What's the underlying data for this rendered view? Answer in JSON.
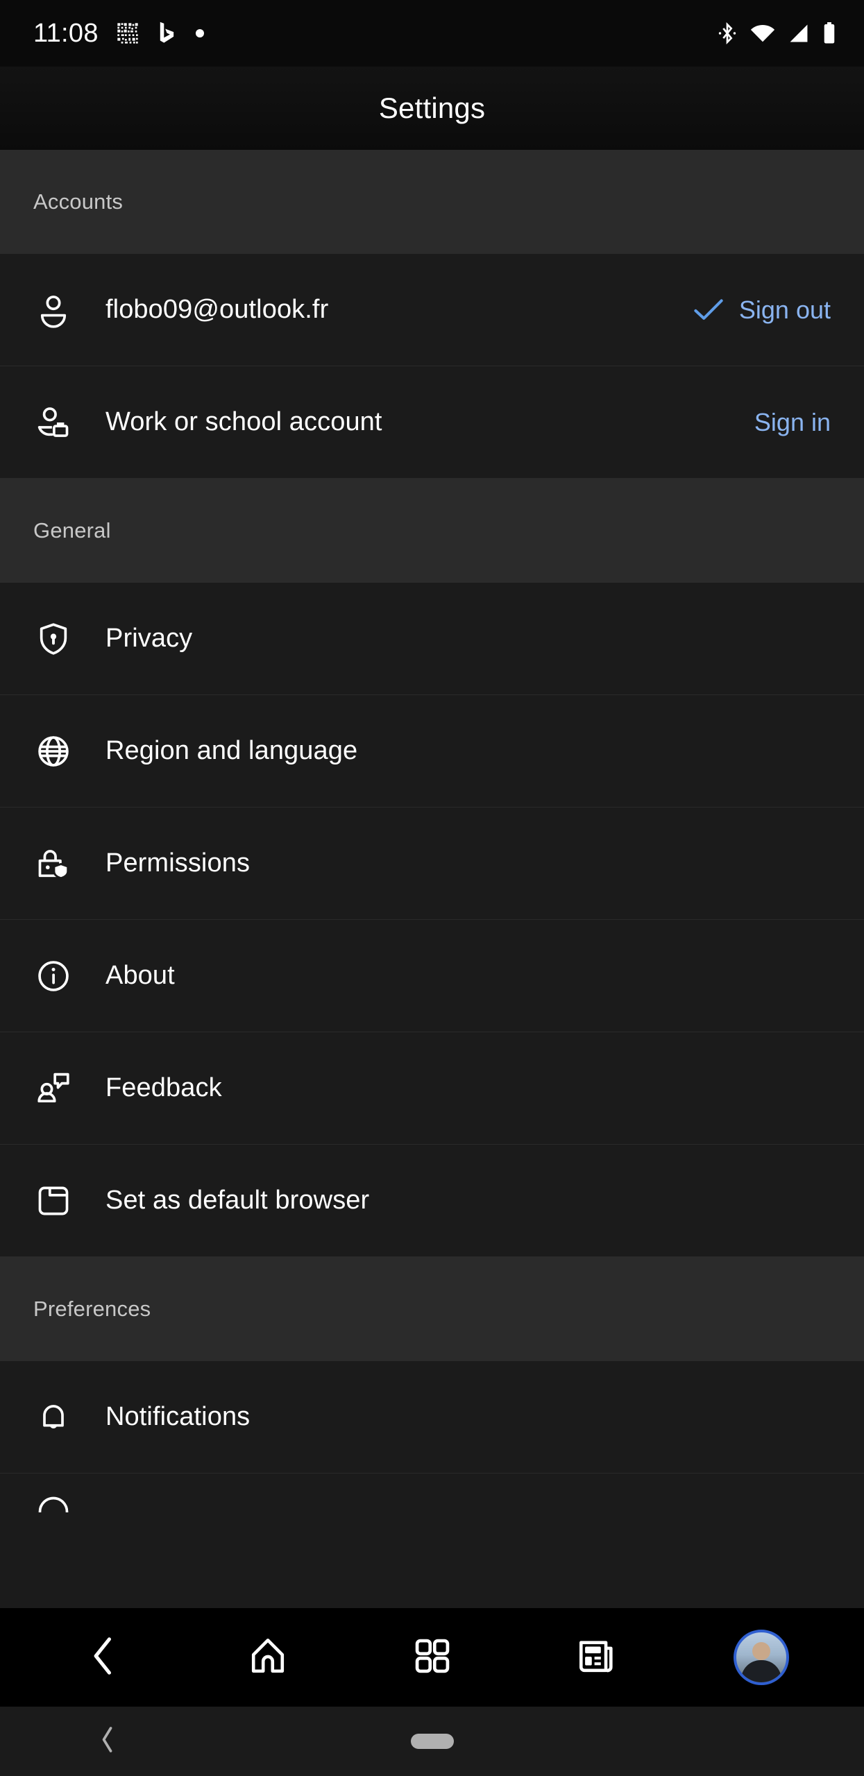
{
  "status_bar": {
    "time": "11:08",
    "left_icons": [
      "qr-code-icon",
      "bing-logo-icon",
      "dot-icon"
    ],
    "right_icons": [
      "bluetooth-icon",
      "wifi-icon",
      "cellular-signal-icon",
      "battery-icon"
    ]
  },
  "header": {
    "title": "Settings"
  },
  "sections": [
    {
      "header": "Accounts",
      "rows": [
        {
          "icon": "person-icon",
          "label": "flobo09@outlook.fr",
          "action": "Sign out",
          "has_check": true
        },
        {
          "icon": "person-briefcase-icon",
          "label": "Work or school account",
          "action": "Sign in",
          "has_check": false
        }
      ]
    },
    {
      "header": "General",
      "rows": [
        {
          "icon": "shield-lock-icon",
          "label": "Privacy"
        },
        {
          "icon": "globe-icon",
          "label": "Region and language"
        },
        {
          "icon": "lock-shield-icon",
          "label": "Permissions"
        },
        {
          "icon": "info-circle-icon",
          "label": "About"
        },
        {
          "icon": "feedback-person-icon",
          "label": "Feedback"
        },
        {
          "icon": "browser-window-icon",
          "label": "Set as default browser"
        }
      ]
    },
    {
      "header": "Preferences",
      "rows": [
        {
          "icon": "bell-icon",
          "label": "Notifications"
        }
      ]
    }
  ],
  "bottom_nav": {
    "items": [
      {
        "icon": "back-chevron-icon",
        "name": "back"
      },
      {
        "icon": "home-icon",
        "name": "home"
      },
      {
        "icon": "grid-apps-icon",
        "name": "apps"
      },
      {
        "icon": "news-icon",
        "name": "news"
      },
      {
        "icon": "avatar-icon",
        "name": "profile"
      }
    ]
  },
  "system_nav": {
    "back": "back-chevron-icon",
    "home": "home-pill"
  },
  "colors": {
    "accent_link": "#8ab4f0",
    "check": "#5f9de8",
    "avatar_ring": "#2f5fd0",
    "background": "#1b1b1b",
    "section_header_bg": "#2b2b2b"
  }
}
